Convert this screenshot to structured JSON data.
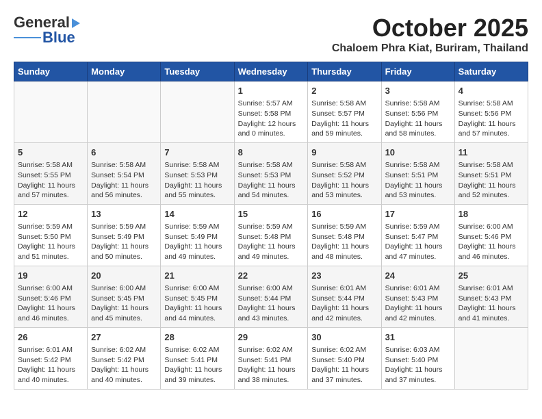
{
  "header": {
    "logo_general": "General",
    "logo_blue": "Blue",
    "month_title": "October 2025",
    "location": "Chaloem Phra Kiat, Buriram, Thailand"
  },
  "weekdays": [
    "Sunday",
    "Monday",
    "Tuesday",
    "Wednesday",
    "Thursday",
    "Friday",
    "Saturday"
  ],
  "weeks": [
    [
      {
        "day": "",
        "info": ""
      },
      {
        "day": "",
        "info": ""
      },
      {
        "day": "",
        "info": ""
      },
      {
        "day": "1",
        "info": "Sunrise: 5:57 AM\nSunset: 5:58 PM\nDaylight: 12 hours\nand 0 minutes."
      },
      {
        "day": "2",
        "info": "Sunrise: 5:58 AM\nSunset: 5:57 PM\nDaylight: 11 hours\nand 59 minutes."
      },
      {
        "day": "3",
        "info": "Sunrise: 5:58 AM\nSunset: 5:56 PM\nDaylight: 11 hours\nand 58 minutes."
      },
      {
        "day": "4",
        "info": "Sunrise: 5:58 AM\nSunset: 5:56 PM\nDaylight: 11 hours\nand 57 minutes."
      }
    ],
    [
      {
        "day": "5",
        "info": "Sunrise: 5:58 AM\nSunset: 5:55 PM\nDaylight: 11 hours\nand 57 minutes."
      },
      {
        "day": "6",
        "info": "Sunrise: 5:58 AM\nSunset: 5:54 PM\nDaylight: 11 hours\nand 56 minutes."
      },
      {
        "day": "7",
        "info": "Sunrise: 5:58 AM\nSunset: 5:53 PM\nDaylight: 11 hours\nand 55 minutes."
      },
      {
        "day": "8",
        "info": "Sunrise: 5:58 AM\nSunset: 5:53 PM\nDaylight: 11 hours\nand 54 minutes."
      },
      {
        "day": "9",
        "info": "Sunrise: 5:58 AM\nSunset: 5:52 PM\nDaylight: 11 hours\nand 53 minutes."
      },
      {
        "day": "10",
        "info": "Sunrise: 5:58 AM\nSunset: 5:51 PM\nDaylight: 11 hours\nand 53 minutes."
      },
      {
        "day": "11",
        "info": "Sunrise: 5:58 AM\nSunset: 5:51 PM\nDaylight: 11 hours\nand 52 minutes."
      }
    ],
    [
      {
        "day": "12",
        "info": "Sunrise: 5:59 AM\nSunset: 5:50 PM\nDaylight: 11 hours\nand 51 minutes."
      },
      {
        "day": "13",
        "info": "Sunrise: 5:59 AM\nSunset: 5:49 PM\nDaylight: 11 hours\nand 50 minutes."
      },
      {
        "day": "14",
        "info": "Sunrise: 5:59 AM\nSunset: 5:49 PM\nDaylight: 11 hours\nand 49 minutes."
      },
      {
        "day": "15",
        "info": "Sunrise: 5:59 AM\nSunset: 5:48 PM\nDaylight: 11 hours\nand 49 minutes."
      },
      {
        "day": "16",
        "info": "Sunrise: 5:59 AM\nSunset: 5:48 PM\nDaylight: 11 hours\nand 48 minutes."
      },
      {
        "day": "17",
        "info": "Sunrise: 5:59 AM\nSunset: 5:47 PM\nDaylight: 11 hours\nand 47 minutes."
      },
      {
        "day": "18",
        "info": "Sunrise: 6:00 AM\nSunset: 5:46 PM\nDaylight: 11 hours\nand 46 minutes."
      }
    ],
    [
      {
        "day": "19",
        "info": "Sunrise: 6:00 AM\nSunset: 5:46 PM\nDaylight: 11 hours\nand 46 minutes."
      },
      {
        "day": "20",
        "info": "Sunrise: 6:00 AM\nSunset: 5:45 PM\nDaylight: 11 hours\nand 45 minutes."
      },
      {
        "day": "21",
        "info": "Sunrise: 6:00 AM\nSunset: 5:45 PM\nDaylight: 11 hours\nand 44 minutes."
      },
      {
        "day": "22",
        "info": "Sunrise: 6:00 AM\nSunset: 5:44 PM\nDaylight: 11 hours\nand 43 minutes."
      },
      {
        "day": "23",
        "info": "Sunrise: 6:01 AM\nSunset: 5:44 PM\nDaylight: 11 hours\nand 42 minutes."
      },
      {
        "day": "24",
        "info": "Sunrise: 6:01 AM\nSunset: 5:43 PM\nDaylight: 11 hours\nand 42 minutes."
      },
      {
        "day": "25",
        "info": "Sunrise: 6:01 AM\nSunset: 5:43 PM\nDaylight: 11 hours\nand 41 minutes."
      }
    ],
    [
      {
        "day": "26",
        "info": "Sunrise: 6:01 AM\nSunset: 5:42 PM\nDaylight: 11 hours\nand 40 minutes."
      },
      {
        "day": "27",
        "info": "Sunrise: 6:02 AM\nSunset: 5:42 PM\nDaylight: 11 hours\nand 40 minutes."
      },
      {
        "day": "28",
        "info": "Sunrise: 6:02 AM\nSunset: 5:41 PM\nDaylight: 11 hours\nand 39 minutes."
      },
      {
        "day": "29",
        "info": "Sunrise: 6:02 AM\nSunset: 5:41 PM\nDaylight: 11 hours\nand 38 minutes."
      },
      {
        "day": "30",
        "info": "Sunrise: 6:02 AM\nSunset: 5:40 PM\nDaylight: 11 hours\nand 37 minutes."
      },
      {
        "day": "31",
        "info": "Sunrise: 6:03 AM\nSunset: 5:40 PM\nDaylight: 11 hours\nand 37 minutes."
      },
      {
        "day": "",
        "info": ""
      }
    ]
  ]
}
